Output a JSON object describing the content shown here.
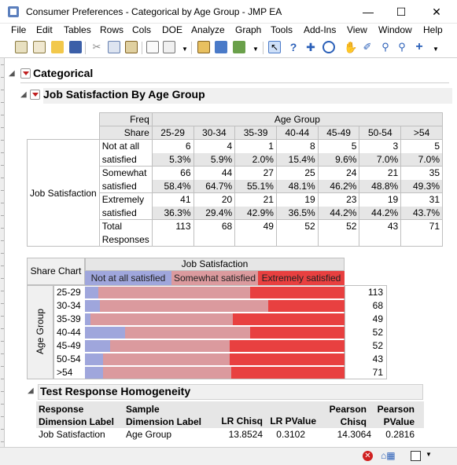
{
  "window": {
    "title": "Consumer Preferences - Categorical by Age Group - JMP EA"
  },
  "menu": [
    "File",
    "Edit",
    "Tables",
    "Rows",
    "Cols",
    "DOE",
    "Analyze",
    "Graph",
    "Tools",
    "Add-Ins",
    "View",
    "Window",
    "Help"
  ],
  "outline": {
    "categorical": "Categorical",
    "job_sat": "Job Satisfaction By Age Group",
    "test": "Test Response Homogeneity"
  },
  "crosstab": {
    "freq": "Freq",
    "share": "Share",
    "age_group": "Age Group",
    "row_header": "Job Satisfaction",
    "ages": [
      "25-29",
      "30-34",
      "35-39",
      "40-44",
      "45-49",
      "50-54",
      ">54"
    ],
    "rows": [
      {
        "l1": "Not at all",
        "l2": "satisfied",
        "counts": [
          "6",
          "4",
          "1",
          "8",
          "5",
          "3",
          "5"
        ],
        "shares": [
          "5.3%",
          "5.9%",
          "2.0%",
          "15.4%",
          "9.6%",
          "7.0%",
          "7.0%"
        ]
      },
      {
        "l1": "Somewhat",
        "l2": "satisfied",
        "counts": [
          "66",
          "44",
          "27",
          "25",
          "24",
          "21",
          "35"
        ],
        "shares": [
          "58.4%",
          "64.7%",
          "55.1%",
          "48.1%",
          "46.2%",
          "48.8%",
          "49.3%"
        ]
      },
      {
        "l1": "Extremely",
        "l2": "satisfied",
        "counts": [
          "41",
          "20",
          "21",
          "19",
          "23",
          "19",
          "31"
        ],
        "shares": [
          "36.3%",
          "29.4%",
          "42.9%",
          "36.5%",
          "44.2%",
          "44.2%",
          "43.7%"
        ]
      }
    ],
    "total_l1": "Total",
    "total_l2": "Responses",
    "totals": [
      "113",
      "68",
      "49",
      "52",
      "52",
      "43",
      "71"
    ]
  },
  "share_chart": {
    "label": "Share Chart",
    "title": "Job Satisfaction",
    "axis": "Age Group",
    "legend": [
      "Not at all satisfied",
      "Somewhat satisfied",
      "Extremely satisfied"
    ],
    "colors": {
      "not": "#9fa6dc",
      "some": "#db9a9e",
      "extreme": "#e84040"
    }
  },
  "chart_data": {
    "type": "bar",
    "categories": [
      "25-29",
      "30-34",
      "35-39",
      "40-44",
      "45-49",
      "50-54",
      ">54"
    ],
    "series": [
      {
        "name": "Not at all satisfied",
        "values": [
          5.3,
          5.9,
          2.0,
          15.4,
          9.6,
          7.0,
          7.0
        ]
      },
      {
        "name": "Somewhat satisfied",
        "values": [
          58.4,
          64.7,
          55.1,
          48.1,
          46.2,
          48.8,
          49.3
        ]
      },
      {
        "name": "Extremely satisfied",
        "values": [
          36.3,
          29.4,
          42.9,
          36.5,
          44.2,
          44.2,
          43.7
        ]
      }
    ],
    "totals": [
      "113",
      "68",
      "49",
      "52",
      "52",
      "43",
      "71"
    ],
    "title": "Job Satisfaction",
    "ylabel": "Age Group"
  },
  "test": {
    "h": [
      "Response",
      "Dimension Label",
      "Sample",
      "Dimension Label",
      "LR Chisq",
      "LR PValue",
      "Pearson",
      "Chisq",
      "Pearson",
      "PValue"
    ],
    "row": [
      "Job Satisfaction",
      "Age Group",
      "13.8524",
      "0.3102",
      "14.3064",
      "0.2816"
    ]
  }
}
